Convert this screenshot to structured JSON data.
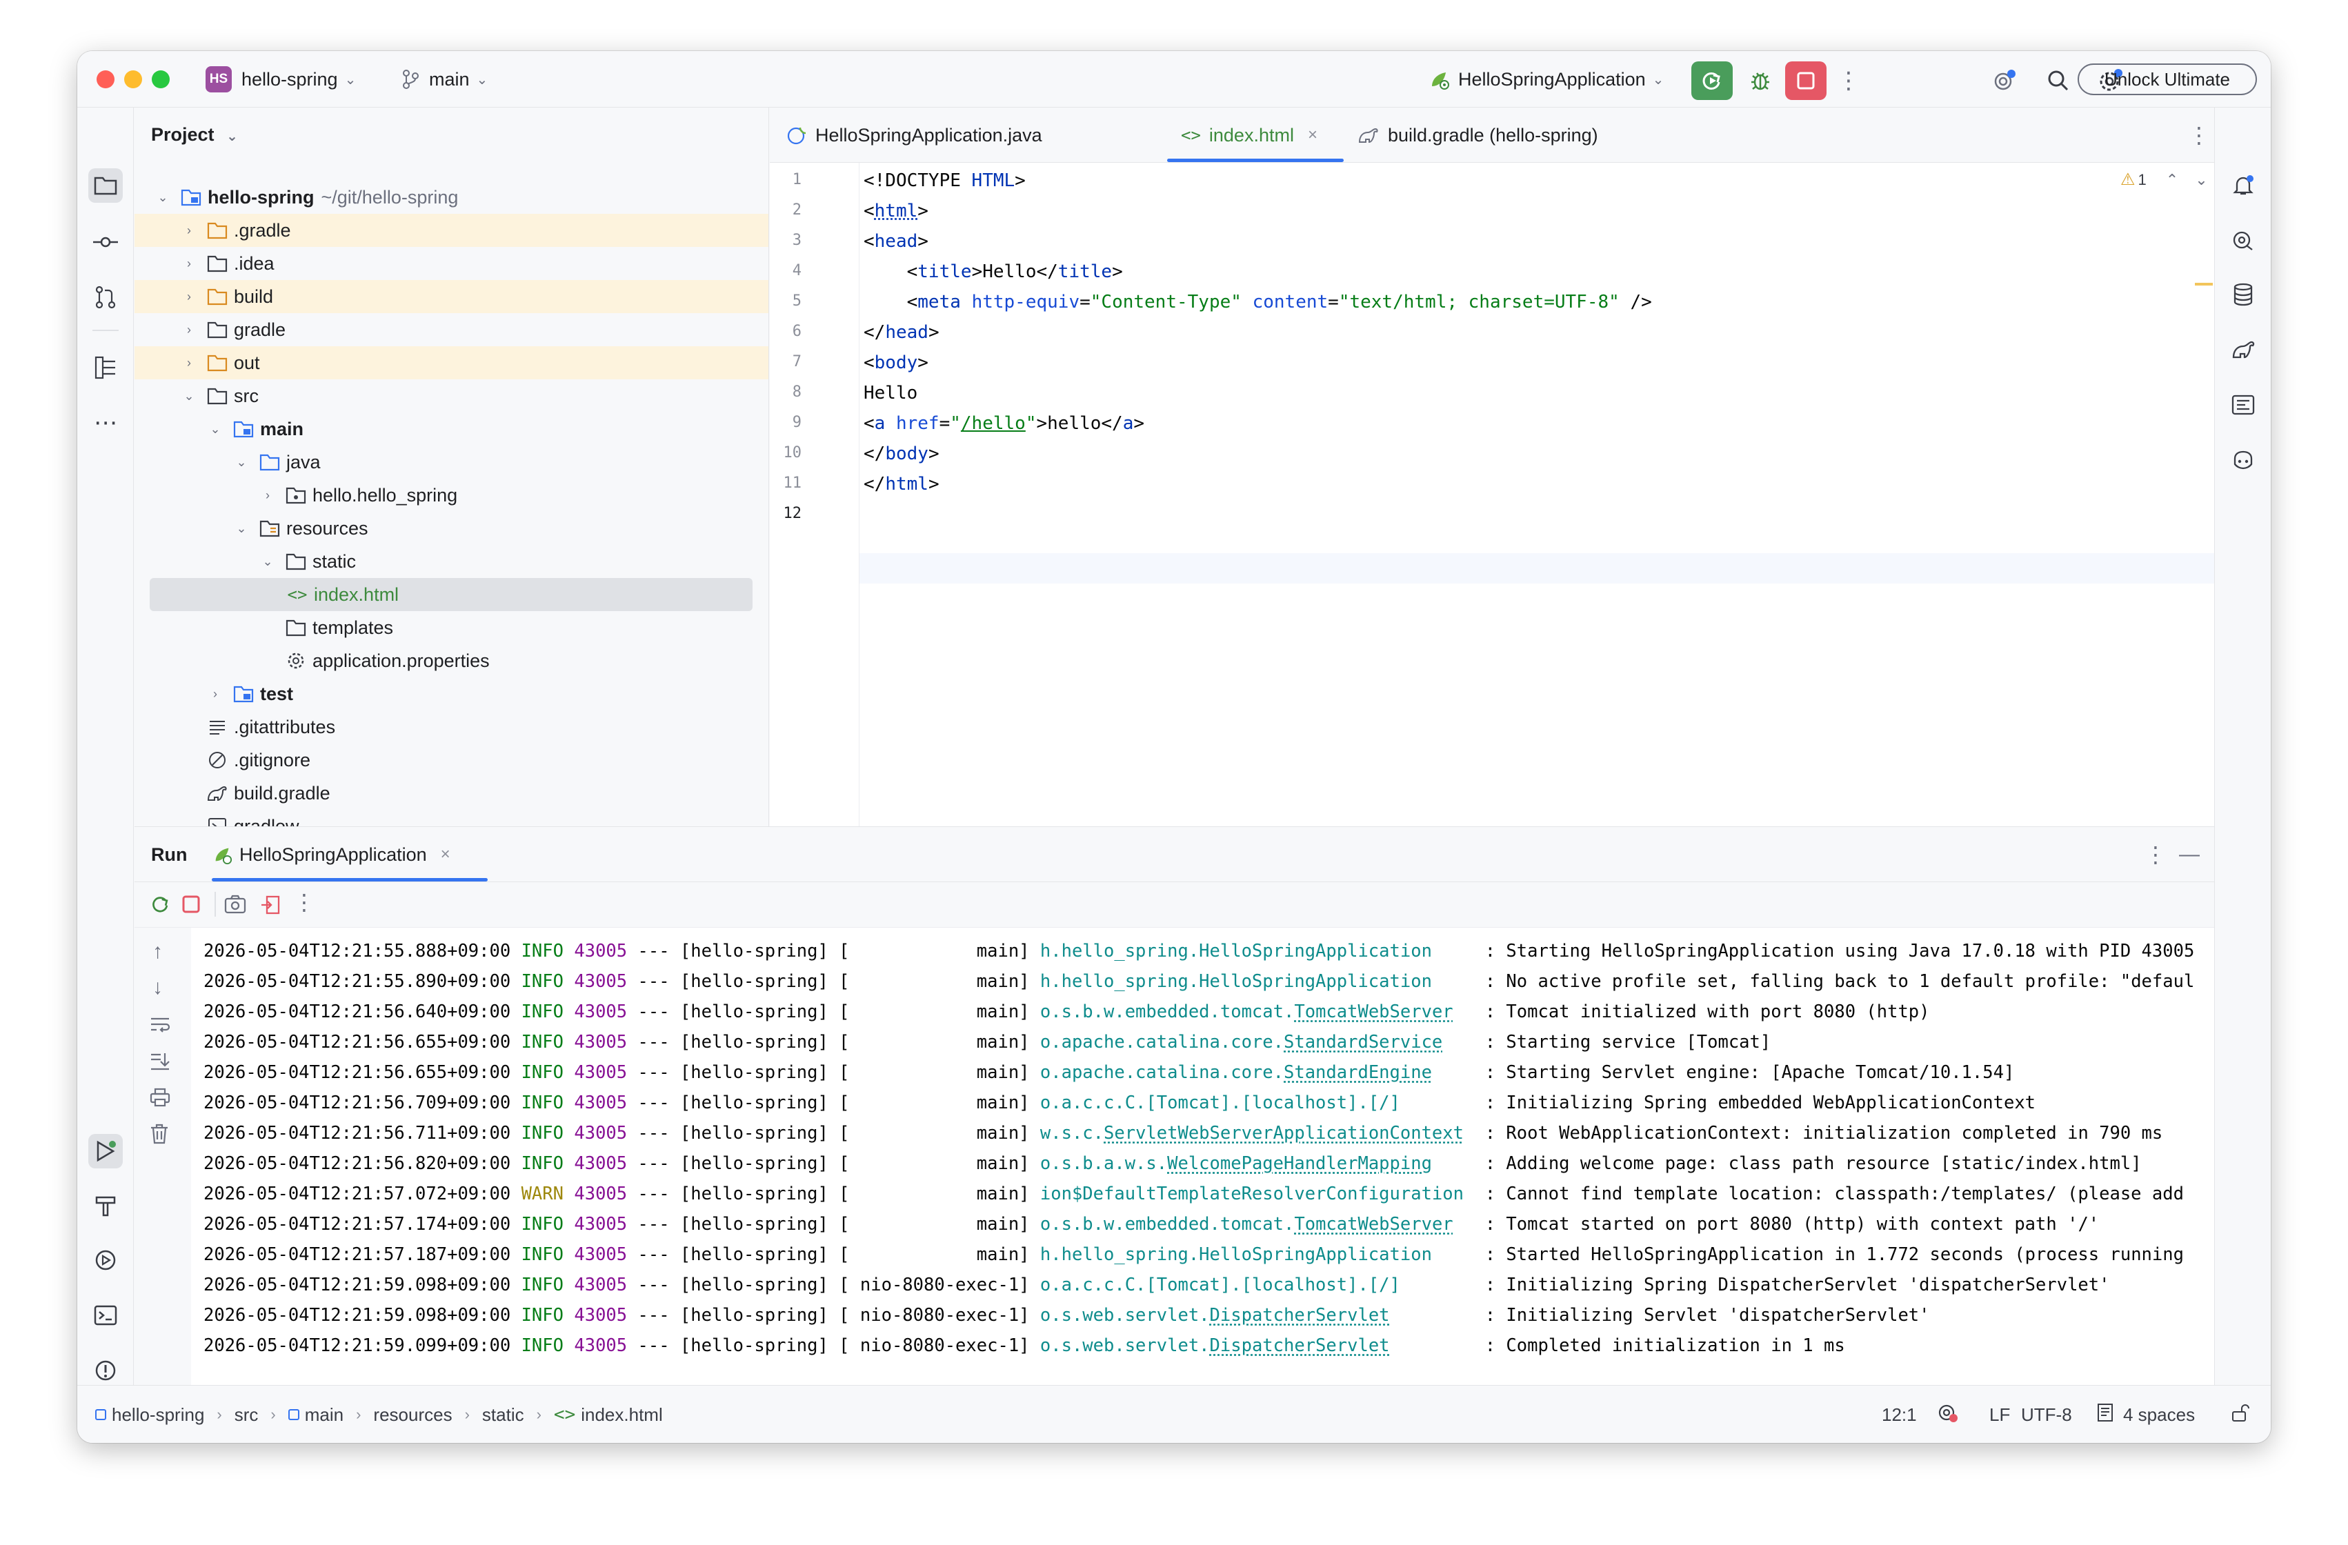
{
  "titlebar": {
    "project_badge": "HS",
    "project_name": "hello-spring",
    "branch": "main",
    "run_config": "HelloSpringApplication",
    "unlock_label": "Unlock Ultimate"
  },
  "project_panel": {
    "title": "Project",
    "root_name": "hello-spring",
    "root_path": "~/git/hello-spring",
    "items": [
      {
        "label": ".gradle"
      },
      {
        "label": ".idea"
      },
      {
        "label": "build"
      },
      {
        "label": "gradle"
      },
      {
        "label": "out"
      },
      {
        "label": "src"
      },
      {
        "label": "main"
      },
      {
        "label": "java"
      },
      {
        "label": "hello.hello_spring"
      },
      {
        "label": "resources"
      },
      {
        "label": "static"
      },
      {
        "label": "index.html"
      },
      {
        "label": "templates"
      },
      {
        "label": "application.properties"
      },
      {
        "label": "test"
      },
      {
        "label": ".gitattributes"
      },
      {
        "label": ".gitignore"
      },
      {
        "label": "build.gradle"
      },
      {
        "label": "gradlew"
      }
    ]
  },
  "editor": {
    "tabs": [
      {
        "label": "HelloSpringApplication.java"
      },
      {
        "label": "index.html"
      },
      {
        "label": "build.gradle (hello-spring)"
      }
    ],
    "warning_count": "1",
    "line_numbers": [
      "1",
      "2",
      "3",
      "4",
      "5",
      "6",
      "7",
      "8",
      "9",
      "10",
      "11",
      "12"
    ]
  },
  "run_panel": {
    "title": "Run",
    "tab_label": "HelloSpringApplication",
    "logs": [
      {
        "ts": "2026-05-04T12:21:55.888+09:00",
        "level": "INFO",
        "pid": "43005",
        "app": "--- [hello-spring] [",
        "thread": "           main]",
        "cls": "h.hello_spring.HelloSpringApplication",
        "msg": "    : Starting HelloSpringApplication using Java 17.0.18 with PID 43005"
      },
      {
        "ts": "2026-05-04T12:21:55.890+09:00",
        "level": "INFO",
        "pid": "43005",
        "app": "--- [hello-spring] [",
        "thread": "           main]",
        "cls": "h.hello_spring.HelloSpringApplication",
        "msg": "    : No active profile set, falling back to 1 default profile: \"defaul"
      },
      {
        "ts": "2026-05-04T12:21:56.640+09:00",
        "level": "INFO",
        "pid": "43005",
        "app": "--- [hello-spring] [",
        "thread": "           main]",
        "cls": "o.s.b.w.embedded.tomcat.TomcatWebServer",
        "msg": "  : Tomcat initialized with port 8080 (http)"
      },
      {
        "ts": "2026-05-04T12:21:56.655+09:00",
        "level": "INFO",
        "pid": "43005",
        "app": "--- [hello-spring] [",
        "thread": "           main]",
        "cls": "o.apache.catalina.core.StandardService",
        "msg": "   : Starting service [Tomcat]"
      },
      {
        "ts": "2026-05-04T12:21:56.655+09:00",
        "level": "INFO",
        "pid": "43005",
        "app": "--- [hello-spring] [",
        "thread": "           main]",
        "cls": "o.apache.catalina.core.StandardEngine",
        "msg": "    : Starting Servlet engine: [Apache Tomcat/10.1.54]"
      },
      {
        "ts": "2026-05-04T12:21:56.709+09:00",
        "level": "INFO",
        "pid": "43005",
        "app": "--- [hello-spring] [",
        "thread": "           main]",
        "cls": "o.a.c.c.C.[Tomcat].[localhost].[/]",
        "msg": "       : Initializing Spring embedded WebApplicationContext"
      },
      {
        "ts": "2026-05-04T12:21:56.711+09:00",
        "level": "INFO",
        "pid": "43005",
        "app": "--- [hello-spring] [",
        "thread": "           main]",
        "cls": "w.s.c.ServletWebServerApplicationContext",
        "msg": " : Root WebApplicationContext: initialization completed in 790 ms"
      },
      {
        "ts": "2026-05-04T12:21:56.820+09:00",
        "level": "INFO",
        "pid": "43005",
        "app": "--- [hello-spring] [",
        "thread": "           main]",
        "cls": "o.s.b.a.w.s.WelcomePageHandlerMapping",
        "msg": "    : Adding welcome page: class path resource [static/index.html]"
      },
      {
        "ts": "2026-05-04T12:21:57.072+09:00",
        "level": "WARN",
        "pid": "43005",
        "app": "--- [hello-spring] [",
        "thread": "           main]",
        "cls": "ion$DefaultTemplateResolverConfiguration",
        "msg": " : Cannot find template location: classpath:/templates/ (please add"
      },
      {
        "ts": "2026-05-04T12:21:57.174+09:00",
        "level": "INFO",
        "pid": "43005",
        "app": "--- [hello-spring] [",
        "thread": "           main]",
        "cls": "o.s.b.w.embedded.tomcat.TomcatWebServer",
        "msg": "  : Tomcat started on port 8080 (http) with context path '/'"
      },
      {
        "ts": "2026-05-04T12:21:57.187+09:00",
        "level": "INFO",
        "pid": "43005",
        "app": "--- [hello-spring] [",
        "thread": "           main]",
        "cls": "h.hello_spring.HelloSpringApplication",
        "msg": "    : Started HelloSpringApplication in 1.772 seconds (process running"
      },
      {
        "ts": "2026-05-04T12:21:59.098+09:00",
        "level": "INFO",
        "pid": "43005",
        "app": "--- [hello-spring] [",
        "thread": "nio-8080-exec-1]",
        "cls": "o.a.c.c.C.[Tomcat].[localhost].[/]",
        "msg": "       : Initializing Spring DispatcherServlet 'dispatcherServlet'"
      },
      {
        "ts": "2026-05-04T12:21:59.098+09:00",
        "level": "INFO",
        "pid": "43005",
        "app": "--- [hello-spring] [",
        "thread": "nio-8080-exec-1]",
        "cls": "o.s.web.servlet.DispatcherServlet",
        "msg": "        : Initializing Servlet 'dispatcherServlet'"
      },
      {
        "ts": "2026-05-04T12:21:59.099+09:00",
        "level": "INFO",
        "pid": "43005",
        "app": "--- [hello-spring] [",
        "thread": "nio-8080-exec-1]",
        "cls": "o.s.web.servlet.DispatcherServlet",
        "msg": "        : Completed initialization in 1 ms"
      }
    ]
  },
  "status_bar": {
    "breadcrumbs": [
      "hello-spring",
      "src",
      "main",
      "resources",
      "static",
      "index.html"
    ],
    "position": "12:1",
    "line_sep": "LF",
    "encoding": "UTF-8",
    "indent": "4 spaces"
  }
}
